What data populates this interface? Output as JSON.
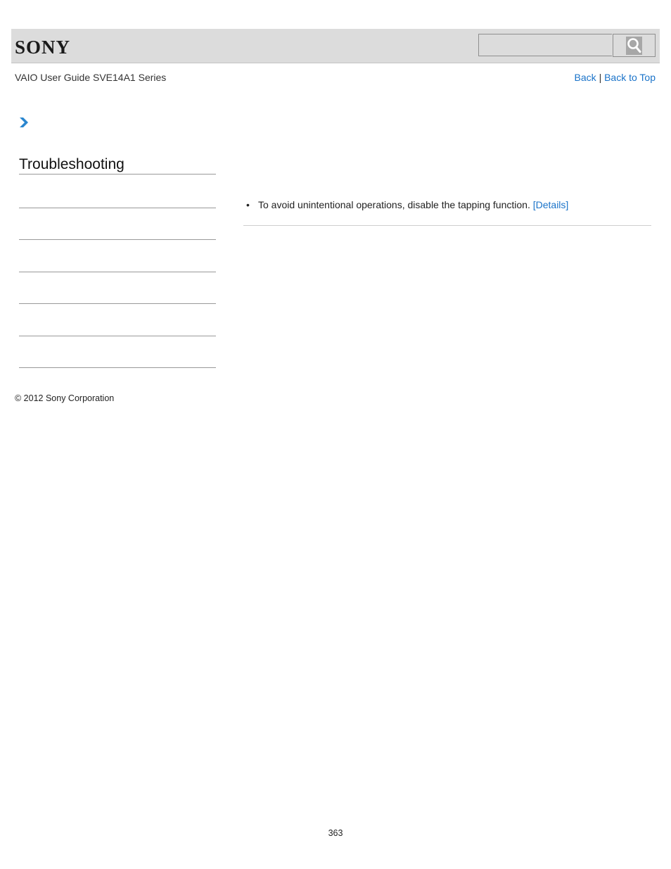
{
  "header": {
    "logo": "SONY",
    "search": {
      "value": "",
      "placeholder": "",
      "button_icon": "search-icon"
    }
  },
  "subheader": {
    "title": "VAIO User Guide SVE14A1 Series",
    "back_label": "Back",
    "separator": "|",
    "back_to_top_label": "Back to Top"
  },
  "breadcrumb": {
    "icon": "chevron-right-icon"
  },
  "sidebar": {
    "title": "Troubleshooting",
    "items": [
      "",
      "",
      "",
      "",
      "",
      ""
    ]
  },
  "content": {
    "items": [
      {
        "bullet": "•",
        "text": "To avoid unintentional operations, disable the tapping function.",
        "link_label": "[Details]"
      }
    ]
  },
  "footer": {
    "copyright": "© 2012 Sony Corporation",
    "page_number": "363"
  },
  "colors": {
    "link": "#1a73c9",
    "header_bg": "#dcdcdc",
    "chevron": "#2a86cf"
  }
}
